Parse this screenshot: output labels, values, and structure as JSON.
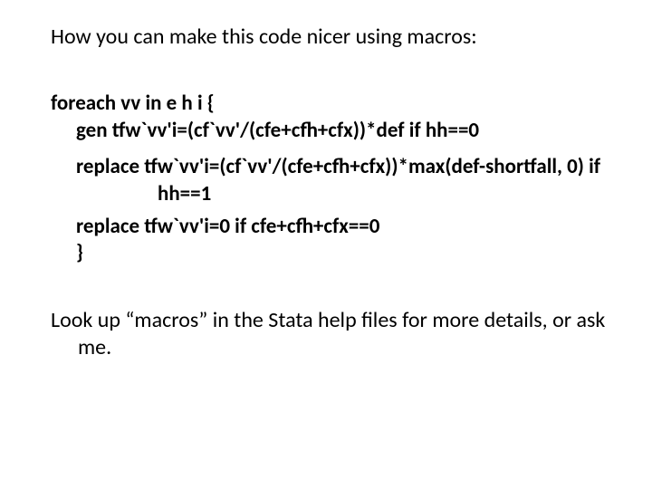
{
  "slide": {
    "title": "How you can make this code nicer using macros:",
    "code": {
      "l1": "foreach vv in e h i {",
      "l2": "gen tfw`vv'i=(cf`vv'/(cfe+cfh+cfx))*def  if hh==0",
      "l3": "replace tfw`vv'i=(cf`vv'/(cfe+cfh+cfx))*max(def-shortfall, 0) if hh==1",
      "l4": "replace tfw`vv'i=0 if cfe+cfh+cfx==0",
      "l5": "}"
    },
    "footer": "Look up “macros” in the Stata help files for more details, or ask me."
  }
}
